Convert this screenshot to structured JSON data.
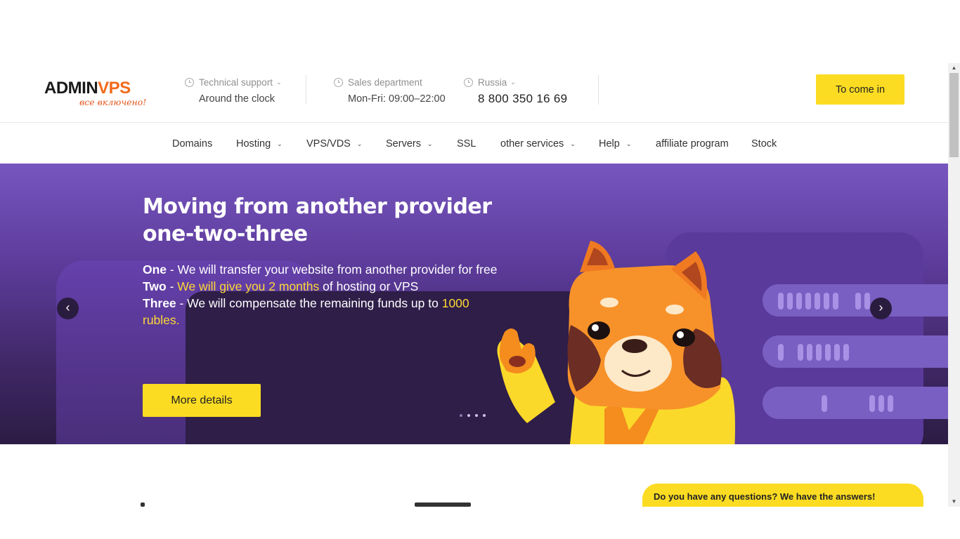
{
  "header": {
    "logo_main": "ADMINVPS",
    "logo_tagline": "все включено!",
    "support": {
      "title": "Technical support",
      "value": "Around the clock"
    },
    "sales": {
      "title": "Sales department",
      "value": "Mon-Fri: 09:00–22:00"
    },
    "region": {
      "title": "Russia",
      "phone": "8 800 350 16 69"
    },
    "login_label": "To come in"
  },
  "nav": {
    "items": [
      {
        "label": "Domains",
        "dropdown": false
      },
      {
        "label": "Hosting",
        "dropdown": true
      },
      {
        "label": "VPS/VDS",
        "dropdown": true
      },
      {
        "label": "Servers",
        "dropdown": true
      },
      {
        "label": "SSL",
        "dropdown": false
      },
      {
        "label": "other services",
        "dropdown": true
      },
      {
        "label": "Help",
        "dropdown": true
      },
      {
        "label": "affiliate program",
        "dropdown": false
      },
      {
        "label": "Stock",
        "dropdown": false
      }
    ]
  },
  "hero": {
    "title_line1": "Moving from another provider",
    "title_line2": "one-two-three",
    "one_label": "One",
    "one_text": " - We will transfer your website from another provider for free",
    "two_label": "Two",
    "two_sep": " - ",
    "two_highlight": "We will give you 2 months",
    "two_text": " of hosting or VPS",
    "three_label": "Three",
    "three_text": " - We will compensate the remaining funds up to ",
    "three_highlight": "1000 rubles.",
    "button_label": "More details",
    "prev_icon": "chevron-left-icon",
    "next_icon": "chevron-right-icon",
    "slide_count": 4,
    "active_slide": 2
  },
  "faq": {
    "label": "Do you have any questions? We have the answers!"
  },
  "colors": {
    "accent": "#fbdc22",
    "brand_orange": "#f26a1b",
    "hero_purple": "#6a4ab5"
  }
}
